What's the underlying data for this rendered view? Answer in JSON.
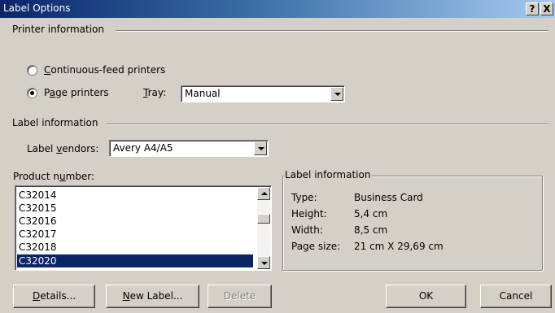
{
  "window": {
    "title": "Label Options",
    "help_button": "?",
    "close_button": "X"
  },
  "printer_information": {
    "heading": "Printer information",
    "continuous_label": {
      "pre": "",
      "mnemonic": "C",
      "post": "ontinuous-feed printers"
    },
    "page_label": {
      "pre": "P",
      "mnemonic": "a",
      "post": "ge printers"
    },
    "selected": "page",
    "tray_label": {
      "pre": "",
      "mnemonic": "T",
      "post": "ray:"
    },
    "tray_value": "Manual"
  },
  "label_information": {
    "heading": "Label information",
    "vendors_label": {
      "pre": "Label ",
      "mnemonic": "v",
      "post": "endors:"
    },
    "vendor_value": "Avery A4/A5"
  },
  "product_number": {
    "label": {
      "pre": "Product n",
      "mnemonic": "u",
      "post": "mber:"
    },
    "items": [
      "C32014",
      "C32015",
      "C32016",
      "C32017",
      "C32018",
      "C32020"
    ],
    "selected_index": 5
  },
  "details_panel": {
    "heading": "Label information",
    "rows": [
      {
        "key": "Type:",
        "value": "Business Card"
      },
      {
        "key": "Height:",
        "value": "5,4 cm"
      },
      {
        "key": "Width:",
        "value": "8,5 cm"
      },
      {
        "key": "Page size:",
        "value": "21 cm X 29,69 cm"
      }
    ]
  },
  "buttons": {
    "details": {
      "pre": "",
      "mnemonic": "D",
      "post": "etails..."
    },
    "new_label": {
      "pre": "",
      "mnemonic": "N",
      "post": "ew Label..."
    },
    "delete": "Delete",
    "ok": "OK",
    "cancel": "Cancel"
  },
  "colors": {
    "titlebar_start": "#0a246a",
    "titlebar_end": "#a6caf0",
    "dialog_face": "#d4d0c8",
    "selection": "#0a246a"
  }
}
